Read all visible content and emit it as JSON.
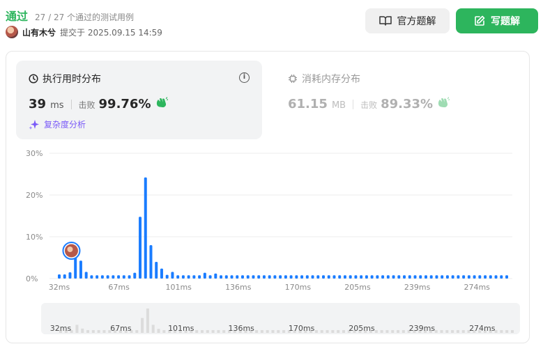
{
  "header": {
    "status": "通过",
    "cases": "27 / 27 个通过的测试用例",
    "username": "山有木兮",
    "submitted": "提交于 2025.09.15 14:59",
    "official_solution_label": "官方题解",
    "write_solution_label": "写题解"
  },
  "runtime": {
    "title": "执行用时分布",
    "value": "39",
    "unit": "ms",
    "beats_label": "击败",
    "beats_value": "99.76%",
    "complexity_label": "复杂度分析"
  },
  "memory": {
    "title": "消耗内存分布",
    "value": "61.15",
    "unit": "MB",
    "beats_label": "击败",
    "beats_value": "89.33%"
  },
  "colors": {
    "accent_green": "#2db55d",
    "bar_blue": "#1a7cff",
    "complexity_purple": "#7a5af8"
  },
  "chart_data": {
    "type": "bar",
    "ylim": [
      0,
      30
    ],
    "y_ticks": [
      "30%",
      "20%",
      "10%",
      "0%"
    ],
    "x_tick_labels": [
      "32ms",
      "67ms",
      "101ms",
      "136ms",
      "170ms",
      "205ms",
      "239ms",
      "274ms"
    ],
    "values": [
      1.0,
      1.0,
      1.5,
      8.0,
      4.3,
      1.6,
      0.8,
      0.8,
      0.8,
      0.8,
      0.8,
      0.8,
      0.8,
      0.8,
      1.4,
      14.8,
      24.2,
      8.0,
      4.0,
      2.4,
      0.9,
      1.6,
      0.8,
      0.8,
      0.8,
      0.8,
      0.8,
      1.4,
      0.8,
      1.2,
      0.8,
      0.8,
      0.8,
      0.8,
      0.8,
      0.8,
      0.8,
      0.8,
      0.8,
      0.8,
      0.8,
      0.8,
      0.8,
      0.8,
      0.8,
      0.8,
      0.8,
      0.8,
      0.8,
      0.8,
      0.8,
      0.8,
      0.8,
      0.8,
      0.8,
      0.8,
      0.8,
      0.8,
      0.8,
      0.8,
      0.8,
      0.8,
      0.8,
      0.8,
      0.8,
      0.8,
      0.8,
      0.8,
      0.8,
      0.8,
      0.8,
      0.8,
      0.8,
      0.8,
      0.8,
      0.8,
      0.8,
      0.8,
      0.8,
      0.8,
      0.8,
      0.8,
      0.8,
      0.8
    ],
    "highlight_index": 2,
    "grid": true
  }
}
